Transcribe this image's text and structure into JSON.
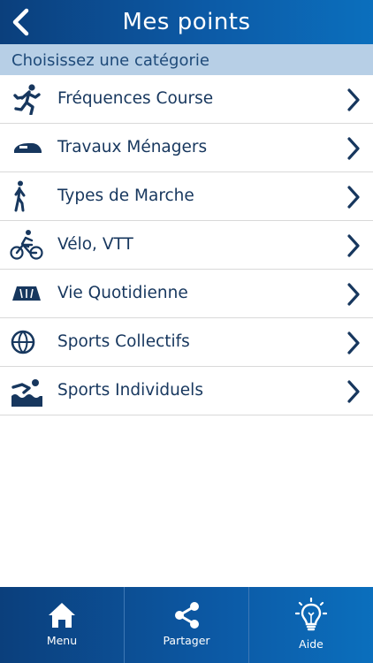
{
  "header": {
    "title": "Mes points"
  },
  "subheader": {
    "label": "Choisissez une catégorie"
  },
  "categories": [
    {
      "label": "Fréquences Course",
      "icon": "running-icon"
    },
    {
      "label": "Travaux Ménagers",
      "icon": "iron-icon"
    },
    {
      "label": "Types de Marche",
      "icon": "walking-icon"
    },
    {
      "label": "Vélo, VTT",
      "icon": "cycling-icon"
    },
    {
      "label": "Vie Quotidienne",
      "icon": "daily-life-icon"
    },
    {
      "label": "Sports Collectifs",
      "icon": "ball-icon"
    },
    {
      "label": "Sports Individuels",
      "icon": "swimming-icon"
    }
  ],
  "bottom_nav": {
    "menu": "Menu",
    "share": "Partager",
    "help": "Aide"
  },
  "colors": {
    "primary": "#0c5aa6",
    "dark": "#0b3f7c",
    "subheader_bg": "#b7cfe6",
    "text": "#17375e"
  }
}
